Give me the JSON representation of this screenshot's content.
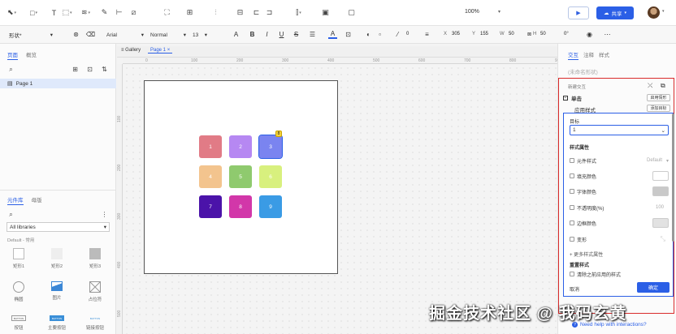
{
  "toolbar": {
    "zoom": "100%",
    "share_label": "共享",
    "accent": "#2b5fe6"
  },
  "format_bar": {
    "style": "形状*",
    "font": "Arial",
    "weight": "Normal",
    "size": "13",
    "border_width": "0",
    "x_label": "X",
    "x": "305",
    "y_label": "Y",
    "y": "155",
    "w_label": "W",
    "w": "50",
    "h_label": "H",
    "h": "50",
    "rotation": "0°"
  },
  "left": {
    "tab_pages": "页面",
    "tab_outline": "概览",
    "page_name": "Page 1",
    "tab_library": "元件库",
    "tab_masters": "母版",
    "library": "All libraries",
    "library_group": "Default - 常用",
    "shapes": [
      "矩形1",
      "矩形2",
      "矩形3",
      "椭圆",
      "图片",
      "占位符",
      "按钮",
      "主要按钮",
      "链接按钮"
    ],
    "button_sample": "BUTTON"
  },
  "canvas": {
    "tab_gallery": "Gallery",
    "tab_page": "Page 1",
    "ruler_h": [
      "0",
      "100",
      "200",
      "300",
      "400",
      "500",
      "600",
      "700",
      "800",
      "900"
    ],
    "ruler_v": [
      "100",
      "200",
      "300",
      "400",
      "500"
    ],
    "badge": "8",
    "cells": [
      {
        "label": "1",
        "color": "#e17b86"
      },
      {
        "label": "2",
        "color": "#b688f2"
      },
      {
        "label": "3",
        "color": "#7a84f0"
      },
      {
        "label": "4",
        "color": "#f3c48e"
      },
      {
        "label": "5",
        "color": "#8fca6e"
      },
      {
        "label": "6",
        "color": "#d8f07e"
      },
      {
        "label": "7",
        "color": "#4b13a9"
      },
      {
        "label": "8",
        "color": "#d237a9"
      },
      {
        "label": "9",
        "color": "#3a9be5"
      }
    ]
  },
  "right": {
    "tab_interactions": "交互",
    "tab_notes": "注释",
    "tab_style": "样式",
    "shape_name": "(未命名形状)",
    "interaction_header": "新建交互",
    "event": "单击",
    "event_btn": "启用情形",
    "action": "应用样式",
    "action_btn": "添加目标",
    "target_label": "目标",
    "target_value": "1",
    "style_props_label": "样式属性",
    "props": [
      {
        "label": "元件样式",
        "value": "Default"
      },
      {
        "label": "填充颜色",
        "value": ""
      },
      {
        "label": "字体颜色",
        "value": ""
      },
      {
        "label": "不透明度(%)",
        "value": "100"
      },
      {
        "label": "边框颜色",
        "value": ""
      },
      {
        "label": "变形",
        "value": ""
      }
    ],
    "more_props": "+ 更多样式属性",
    "reset_label": "重置样式",
    "reset_option": "清除之前应用的样式",
    "cancel": "取消",
    "confirm": "确定",
    "help": "Need help with interactions?"
  },
  "watermark": "掘金技术社区 @ 我码玄黄"
}
